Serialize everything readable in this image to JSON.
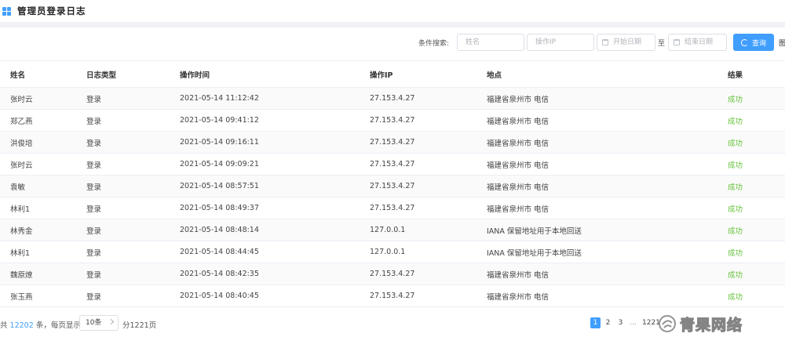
{
  "header": {
    "title": "管理员登录日志"
  },
  "search": {
    "label": "条件搜索:",
    "name_placeholder": "姓名",
    "ip_placeholder": "操作IP",
    "start_date_placeholder": "开始日期",
    "to_label": "至",
    "end_date_placeholder": "结束日期",
    "query_label": "查询",
    "cut_button_label": "图"
  },
  "table": {
    "columns": [
      "姓名",
      "日志类型",
      "操作时间",
      "操作IP",
      "地点",
      "结果"
    ],
    "rows": [
      [
        "张时云",
        "登录",
        "2021-05-14 11:12:42",
        "27.153.4.27",
        "福建省泉州市 电信",
        "成功"
      ],
      [
        "郑乙燕",
        "登录",
        "2021-05-14 09:41:12",
        "27.153.4.27",
        "福建省泉州市 电信",
        "成功"
      ],
      [
        "洪俊培",
        "登录",
        "2021-05-14 09:16:11",
        "27.153.4.27",
        "福建省泉州市 电信",
        "成功"
      ],
      [
        "张时云",
        "登录",
        "2021-05-14 09:09:21",
        "27.153.4.27",
        "福建省泉州市 电信",
        "成功"
      ],
      [
        "袁敏",
        "登录",
        "2021-05-14 08:57:51",
        "27.153.4.27",
        "福建省泉州市 电信",
        "成功"
      ],
      [
        "林利1",
        "登录",
        "2021-05-14 08:49:37",
        "27.153.4.27",
        "福建省泉州市 电信",
        "成功"
      ],
      [
        "林秀金",
        "登录",
        "2021-05-14 08:48:14",
        "127.0.0.1",
        "IANA 保留地址用于本地回送",
        "成功"
      ],
      [
        "林利1",
        "登录",
        "2021-05-14 08:44:45",
        "127.0.0.1",
        "IANA 保留地址用于本地回送",
        "成功"
      ],
      [
        "魏原燎",
        "登录",
        "2021-05-14 08:42:35",
        "27.153.4.27",
        "福建省泉州市 电信",
        "成功"
      ],
      [
        "张玉燕",
        "登录",
        "2021-05-14 08:40:45",
        "27.153.4.27",
        "福建省泉州市 电信",
        "成功"
      ]
    ]
  },
  "pagination": {
    "total_prefix": "共",
    "total": "12202",
    "total_suffix": "条，每页显示",
    "page_size": "10条",
    "page_count": "分1221页",
    "pages": [
      "1",
      "2",
      "3",
      "...",
      "1221"
    ],
    "current_page": "1"
  },
  "watermark": {
    "text": "青果网络"
  },
  "colors": {
    "accent": "#409eff",
    "success": "#67c23a"
  }
}
